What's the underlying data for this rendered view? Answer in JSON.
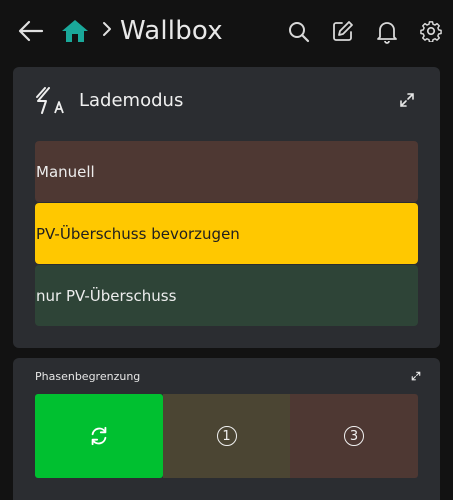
{
  "header": {
    "title": "Wallbox",
    "icons": [
      "back-arrow-icon",
      "home-icon",
      "chevron-right-icon",
      "search-icon",
      "edit-icon",
      "bell-icon",
      "gear-icon"
    ],
    "home_color": "#1aa89a"
  },
  "charge_mode": {
    "title": "Lademodus",
    "icon": "flash-auto-icon",
    "options": [
      {
        "label": "Manuell",
        "color": "#4e3833",
        "selected": false
      },
      {
        "label": "PV-Überschuss bevorzugen",
        "color": "#ffc800",
        "selected": true
      },
      {
        "label": "nur PV-Überschuss",
        "color": "#2e4437",
        "selected": false
      }
    ]
  },
  "phase_limit": {
    "title": "Phasenbegrenzung",
    "options": [
      {
        "icon": "refresh-icon",
        "color": "#00c030",
        "selected": true
      },
      {
        "label": "1",
        "color": "#4b4533",
        "selected": false
      },
      {
        "label": "3",
        "color": "#4e3833",
        "selected": false
      }
    ]
  }
}
